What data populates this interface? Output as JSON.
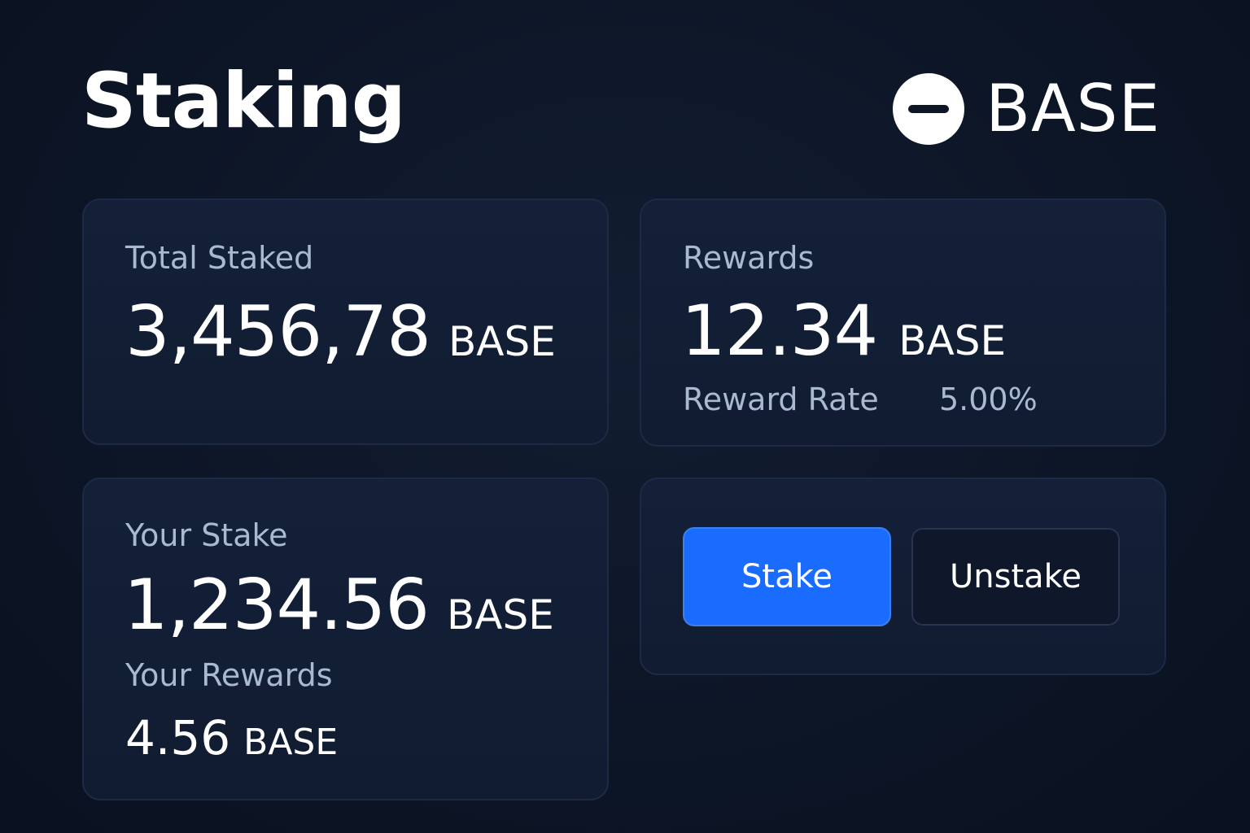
{
  "header": {
    "title": "Staking",
    "token": {
      "icon": "minus-circle-icon",
      "name": "BASE"
    }
  },
  "total_staked": {
    "label": "Total Staked",
    "value": "3,456,78",
    "unit": "BASE"
  },
  "rewards": {
    "label": "Rewards",
    "value": "12.34",
    "unit": "BASE",
    "rate_label": "Reward Rate",
    "rate_value": "5.00%"
  },
  "your_stake": {
    "label": "Your Stake",
    "value": "1,234.56",
    "unit": "BASE",
    "rewards_label": "Your Rewards",
    "rewards_value": "4.56",
    "rewards_unit": "BASE"
  },
  "actions": {
    "stake_label": "Stake",
    "unstake_label": "Unstake"
  },
  "colors": {
    "background": "#0d1627",
    "card": "#132038",
    "accent": "#1a6cff",
    "muted_text": "#a9b9cf"
  }
}
